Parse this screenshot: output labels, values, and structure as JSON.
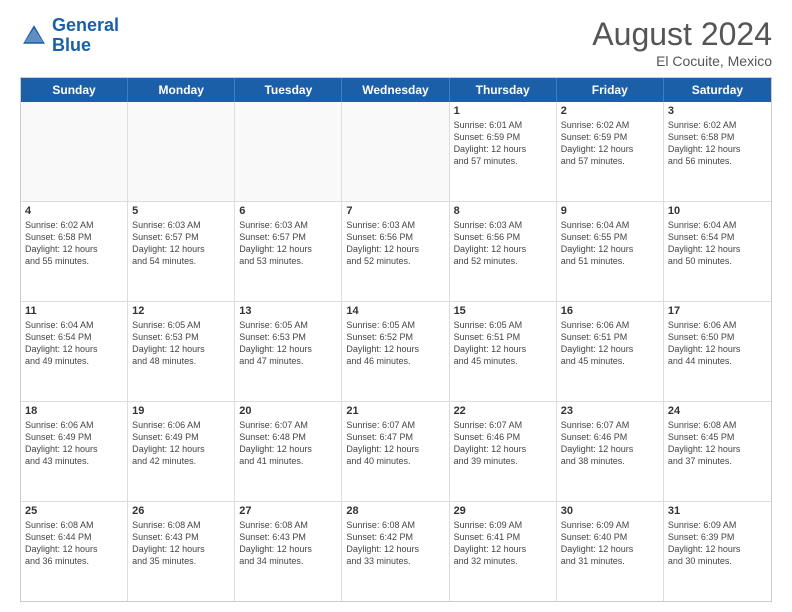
{
  "header": {
    "logo_line1": "General",
    "logo_line2": "Blue",
    "month_year": "August 2024",
    "location": "El Cocuite, Mexico"
  },
  "weekdays": [
    "Sunday",
    "Monday",
    "Tuesday",
    "Wednesday",
    "Thursday",
    "Friday",
    "Saturday"
  ],
  "rows": [
    [
      {
        "day": "",
        "text": ""
      },
      {
        "day": "",
        "text": ""
      },
      {
        "day": "",
        "text": ""
      },
      {
        "day": "",
        "text": ""
      },
      {
        "day": "1",
        "text": "Sunrise: 6:01 AM\nSunset: 6:59 PM\nDaylight: 12 hours\nand 57 minutes."
      },
      {
        "day": "2",
        "text": "Sunrise: 6:02 AM\nSunset: 6:59 PM\nDaylight: 12 hours\nand 57 minutes."
      },
      {
        "day": "3",
        "text": "Sunrise: 6:02 AM\nSunset: 6:58 PM\nDaylight: 12 hours\nand 56 minutes."
      }
    ],
    [
      {
        "day": "4",
        "text": "Sunrise: 6:02 AM\nSunset: 6:58 PM\nDaylight: 12 hours\nand 55 minutes."
      },
      {
        "day": "5",
        "text": "Sunrise: 6:03 AM\nSunset: 6:57 PM\nDaylight: 12 hours\nand 54 minutes."
      },
      {
        "day": "6",
        "text": "Sunrise: 6:03 AM\nSunset: 6:57 PM\nDaylight: 12 hours\nand 53 minutes."
      },
      {
        "day": "7",
        "text": "Sunrise: 6:03 AM\nSunset: 6:56 PM\nDaylight: 12 hours\nand 52 minutes."
      },
      {
        "day": "8",
        "text": "Sunrise: 6:03 AM\nSunset: 6:56 PM\nDaylight: 12 hours\nand 52 minutes."
      },
      {
        "day": "9",
        "text": "Sunrise: 6:04 AM\nSunset: 6:55 PM\nDaylight: 12 hours\nand 51 minutes."
      },
      {
        "day": "10",
        "text": "Sunrise: 6:04 AM\nSunset: 6:54 PM\nDaylight: 12 hours\nand 50 minutes."
      }
    ],
    [
      {
        "day": "11",
        "text": "Sunrise: 6:04 AM\nSunset: 6:54 PM\nDaylight: 12 hours\nand 49 minutes."
      },
      {
        "day": "12",
        "text": "Sunrise: 6:05 AM\nSunset: 6:53 PM\nDaylight: 12 hours\nand 48 minutes."
      },
      {
        "day": "13",
        "text": "Sunrise: 6:05 AM\nSunset: 6:53 PM\nDaylight: 12 hours\nand 47 minutes."
      },
      {
        "day": "14",
        "text": "Sunrise: 6:05 AM\nSunset: 6:52 PM\nDaylight: 12 hours\nand 46 minutes."
      },
      {
        "day": "15",
        "text": "Sunrise: 6:05 AM\nSunset: 6:51 PM\nDaylight: 12 hours\nand 45 minutes."
      },
      {
        "day": "16",
        "text": "Sunrise: 6:06 AM\nSunset: 6:51 PM\nDaylight: 12 hours\nand 45 minutes."
      },
      {
        "day": "17",
        "text": "Sunrise: 6:06 AM\nSunset: 6:50 PM\nDaylight: 12 hours\nand 44 minutes."
      }
    ],
    [
      {
        "day": "18",
        "text": "Sunrise: 6:06 AM\nSunset: 6:49 PM\nDaylight: 12 hours\nand 43 minutes."
      },
      {
        "day": "19",
        "text": "Sunrise: 6:06 AM\nSunset: 6:49 PM\nDaylight: 12 hours\nand 42 minutes."
      },
      {
        "day": "20",
        "text": "Sunrise: 6:07 AM\nSunset: 6:48 PM\nDaylight: 12 hours\nand 41 minutes."
      },
      {
        "day": "21",
        "text": "Sunrise: 6:07 AM\nSunset: 6:47 PM\nDaylight: 12 hours\nand 40 minutes."
      },
      {
        "day": "22",
        "text": "Sunrise: 6:07 AM\nSunset: 6:46 PM\nDaylight: 12 hours\nand 39 minutes."
      },
      {
        "day": "23",
        "text": "Sunrise: 6:07 AM\nSunset: 6:46 PM\nDaylight: 12 hours\nand 38 minutes."
      },
      {
        "day": "24",
        "text": "Sunrise: 6:08 AM\nSunset: 6:45 PM\nDaylight: 12 hours\nand 37 minutes."
      }
    ],
    [
      {
        "day": "25",
        "text": "Sunrise: 6:08 AM\nSunset: 6:44 PM\nDaylight: 12 hours\nand 36 minutes."
      },
      {
        "day": "26",
        "text": "Sunrise: 6:08 AM\nSunset: 6:43 PM\nDaylight: 12 hours\nand 35 minutes."
      },
      {
        "day": "27",
        "text": "Sunrise: 6:08 AM\nSunset: 6:43 PM\nDaylight: 12 hours\nand 34 minutes."
      },
      {
        "day": "28",
        "text": "Sunrise: 6:08 AM\nSunset: 6:42 PM\nDaylight: 12 hours\nand 33 minutes."
      },
      {
        "day": "29",
        "text": "Sunrise: 6:09 AM\nSunset: 6:41 PM\nDaylight: 12 hours\nand 32 minutes."
      },
      {
        "day": "30",
        "text": "Sunrise: 6:09 AM\nSunset: 6:40 PM\nDaylight: 12 hours\nand 31 minutes."
      },
      {
        "day": "31",
        "text": "Sunrise: 6:09 AM\nSunset: 6:39 PM\nDaylight: 12 hours\nand 30 minutes."
      }
    ]
  ]
}
